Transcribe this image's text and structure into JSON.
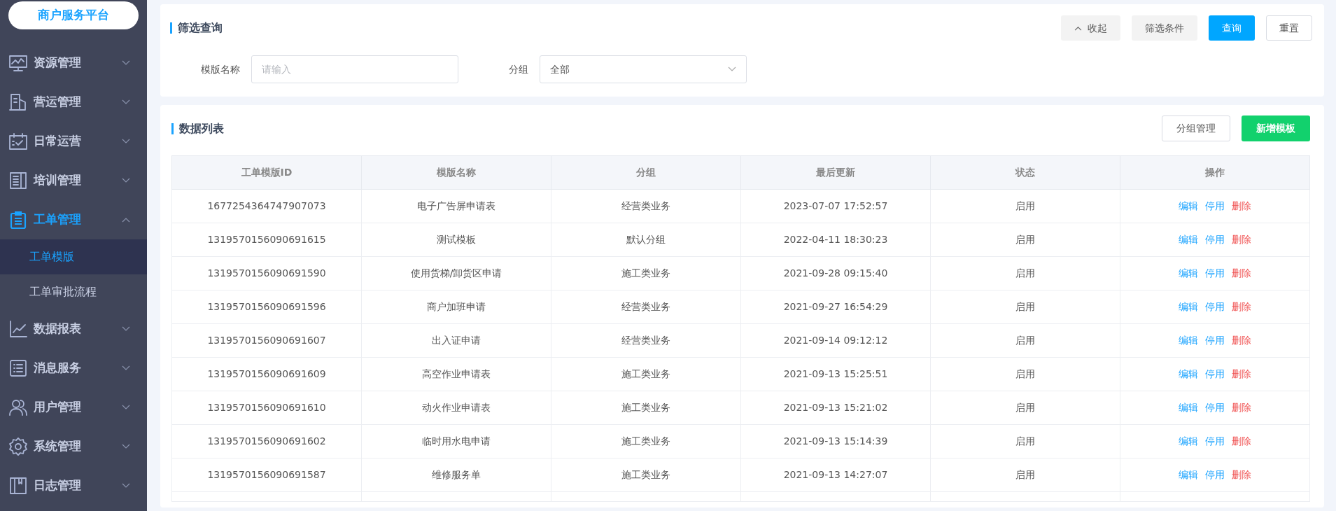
{
  "sidebar": {
    "logo": "商户服务平台",
    "items": [
      {
        "label": "资源管理",
        "selected": false,
        "expanded": false
      },
      {
        "label": "营运管理",
        "selected": false,
        "expanded": false
      },
      {
        "label": "日常运营",
        "selected": false,
        "expanded": false
      },
      {
        "label": "培训管理",
        "selected": false,
        "expanded": false
      },
      {
        "label": "工单管理",
        "selected": true,
        "expanded": true,
        "children": [
          {
            "label": "工单模版",
            "selected": true
          },
          {
            "label": "工单审批流程",
            "selected": false
          }
        ]
      },
      {
        "label": "数据报表",
        "selected": false,
        "expanded": false
      },
      {
        "label": "消息服务",
        "selected": false,
        "expanded": false
      },
      {
        "label": "用户管理",
        "selected": false,
        "expanded": false
      },
      {
        "label": "系统管理",
        "selected": false,
        "expanded": false
      },
      {
        "label": "日志管理",
        "selected": false,
        "expanded": false
      }
    ]
  },
  "filter": {
    "title": "筛选查询",
    "buttons": [
      {
        "label": "收起",
        "kind": "collapse"
      },
      {
        "label": "筛选条件",
        "kind": "secondary"
      },
      {
        "label": "查询",
        "kind": "primary"
      },
      {
        "label": "重置",
        "kind": "outline"
      }
    ],
    "fields": [
      {
        "label": "模版名称",
        "kind": "text",
        "placeholder": "请输入"
      },
      {
        "label": "分组",
        "kind": "select",
        "value": "全部"
      }
    ]
  },
  "list": {
    "title": "数据列表",
    "buttons": [
      {
        "label": "分组管理",
        "kind": "outline"
      },
      {
        "label": "新增模板",
        "kind": "success"
      }
    ],
    "table": {
      "columns": [
        "工单模版ID",
        "模版名称",
        "分组",
        "最后更新",
        "状态",
        "操作"
      ],
      "rows": [
        {
          "cells": [
            "1677254364747907073",
            "电子广告屏申请表",
            "经营类业务",
            "2023-07-07 17:52:57",
            "启用"
          ],
          "actions": [
            {
              "label": "编辑",
              "kind": "primary"
            },
            {
              "label": "停用",
              "kind": "primary"
            },
            {
              "label": "删除",
              "kind": "danger"
            }
          ]
        },
        {
          "cells": [
            "1319570156090691615",
            "测试模板",
            "默认分组",
            "2022-04-11 18:30:23",
            "启用"
          ],
          "actions": [
            {
              "label": "编辑",
              "kind": "primary"
            },
            {
              "label": "停用",
              "kind": "primary"
            },
            {
              "label": "删除",
              "kind": "danger"
            }
          ]
        },
        {
          "cells": [
            "1319570156090691590",
            "使用货梯/卸货区申请",
            "施工类业务",
            "2021-09-28 09:15:40",
            "启用"
          ],
          "actions": [
            {
              "label": "编辑",
              "kind": "primary"
            },
            {
              "label": "停用",
              "kind": "primary"
            },
            {
              "label": "删除",
              "kind": "danger"
            }
          ]
        },
        {
          "cells": [
            "1319570156090691596",
            "商户加班申请",
            "经营类业务",
            "2021-09-27 16:54:29",
            "启用"
          ],
          "actions": [
            {
              "label": "编辑",
              "kind": "primary"
            },
            {
              "label": "停用",
              "kind": "primary"
            },
            {
              "label": "删除",
              "kind": "danger"
            }
          ]
        },
        {
          "cells": [
            "1319570156090691607",
            "出入证申请",
            "经营类业务",
            "2021-09-14 09:12:12",
            "启用"
          ],
          "actions": [
            {
              "label": "编辑",
              "kind": "primary"
            },
            {
              "label": "停用",
              "kind": "primary"
            },
            {
              "label": "删除",
              "kind": "danger"
            }
          ]
        },
        {
          "cells": [
            "1319570156090691609",
            "高空作业申请表",
            "施工类业务",
            "2021-09-13 15:25:51",
            "启用"
          ],
          "actions": [
            {
              "label": "编辑",
              "kind": "primary"
            },
            {
              "label": "停用",
              "kind": "primary"
            },
            {
              "label": "删除",
              "kind": "danger"
            }
          ]
        },
        {
          "cells": [
            "1319570156090691610",
            "动火作业申请表",
            "施工类业务",
            "2021-09-13 15:21:02",
            "启用"
          ],
          "actions": [
            {
              "label": "编辑",
              "kind": "primary"
            },
            {
              "label": "停用",
              "kind": "primary"
            },
            {
              "label": "删除",
              "kind": "danger"
            }
          ]
        },
        {
          "cells": [
            "1319570156090691602",
            "临时用水电申请",
            "施工类业务",
            "2021-09-13 15:14:39",
            "启用"
          ],
          "actions": [
            {
              "label": "编辑",
              "kind": "primary"
            },
            {
              "label": "停用",
              "kind": "primary"
            },
            {
              "label": "删除",
              "kind": "danger"
            }
          ]
        },
        {
          "cells": [
            "1319570156090691587",
            "维修服务单",
            "施工类业务",
            "2021-09-13 14:27:07",
            "启用"
          ],
          "actions": [
            {
              "label": "编辑",
              "kind": "primary"
            },
            {
              "label": "停用",
              "kind": "primary"
            },
            {
              "label": "删除",
              "kind": "danger"
            }
          ]
        }
      ]
    }
  }
}
